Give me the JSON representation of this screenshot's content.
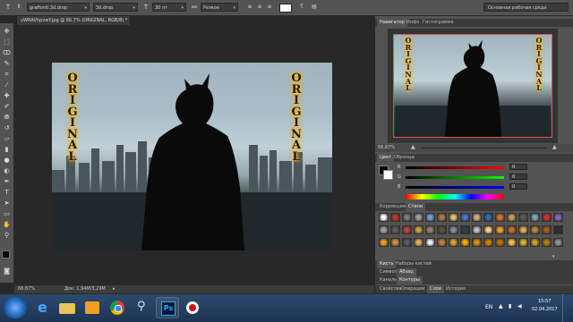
{
  "options_bar": {
    "preset_value": "graffonti.3d.drop",
    "font_style_value": "3d.drop",
    "font_size_value": "30 пт",
    "antialias_value": "Резкое",
    "workspace_label": "Основная рабочая среда"
  },
  "document": {
    "tab_title": "uWRAVhpvwY.jpg @ 66,7% (ORIGINAL, RGB/8) *",
    "zoom": "66,67%",
    "doc_info": "Док: 1,94M/3,29M",
    "graffiti_text": [
      "O",
      "R",
      "I",
      "G",
      "I",
      "N",
      "A",
      "L"
    ]
  },
  "navigator": {
    "tabs": [
      "Навигатор",
      "Инфо",
      "Гистограмма"
    ],
    "zoom": "66,67%"
  },
  "color_panel": {
    "tabs": [
      "Цвет",
      "Образцы"
    ],
    "labels": [
      "R",
      "G",
      "B"
    ],
    "values": [
      "0",
      "0",
      "0"
    ],
    "fg_color": "#000000",
    "bg_color": "#ffffff"
  },
  "styles_panel": {
    "tabs": [
      "Коррекция",
      "Стили"
    ]
  },
  "lower_panels": {
    "row1": [
      "Кисть",
      "Наборы кистей"
    ],
    "row2": [
      "Символ",
      "Абзац"
    ],
    "row3": [
      "Каналы",
      "Контуры"
    ],
    "row4": [
      "Свойства",
      "Операции",
      "Слои",
      "История"
    ]
  },
  "taskbar": {
    "apps": [
      "start-orb",
      "ie",
      "folder",
      "chrome",
      "search",
      "photoshop",
      "media",
      "recorder"
    ],
    "language": "EN",
    "time": "15:57",
    "date": "02.04.2017"
  },
  "colors": {
    "app_bg": "#282828",
    "panel_bg": "#535353",
    "accent_selection": "#e05050",
    "graffiti_glow": "#ffb000"
  }
}
